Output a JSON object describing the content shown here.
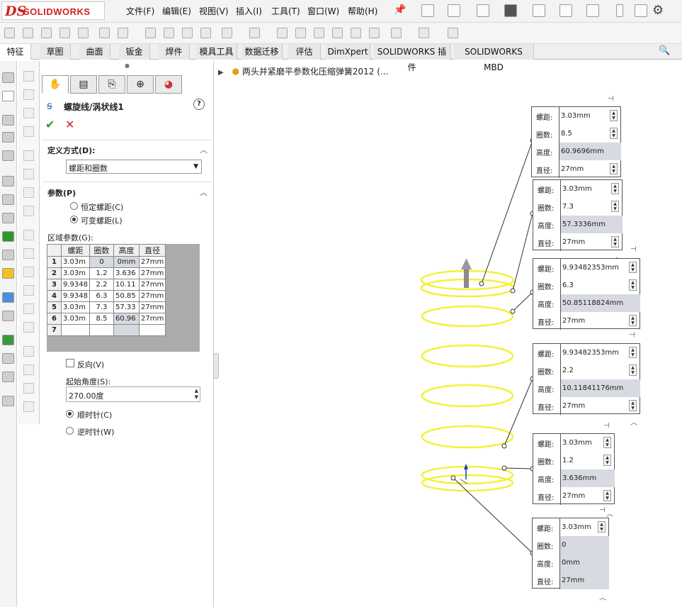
{
  "app": {
    "name": "SOLIDWORKS",
    "logo_ds": "DS"
  },
  "menu": [
    "文件(F)",
    "编辑(E)",
    "视图(V)",
    "插入(I)",
    "工具(T)",
    "窗口(W)",
    "帮助(H)"
  ],
  "tabs": [
    "特征",
    "草图",
    "曲面",
    "钣金",
    "焊件",
    "模具工具",
    "数据迁移",
    "评估",
    "DimXpert",
    "SOLIDWORKS 插件",
    "SOLIDWORKS MBD"
  ],
  "feature_tree": {
    "title": "两头并紧磨平参数化压缩弹簧2012 (..."
  },
  "property_manager": {
    "title": "螺旋线/涡状线1",
    "definition": {
      "title": "定义方式(D):",
      "selected": "螺距和圈数"
    },
    "parameters": {
      "title": "参数(P)",
      "options": [
        "恒定螺距(C)",
        "可变螺距(L)"
      ],
      "selected_index": 1,
      "region_label": "区域参数(G):",
      "columns": [
        "螺距",
        "圈数",
        "高度",
        "直径"
      ],
      "rows": [
        [
          "1",
          "3.03m",
          "0",
          "0mm",
          "27mm"
        ],
        [
          "2",
          "3.03m",
          "1.2",
          "3.636",
          "27mm"
        ],
        [
          "3",
          "9.9348",
          "2.2",
          "10.11",
          "27mm"
        ],
        [
          "4",
          "9.9348",
          "6.3",
          "50.85",
          "27mm"
        ],
        [
          "5",
          "3.03m",
          "7.3",
          "57.33",
          "27mm"
        ],
        [
          "6",
          "3.03m",
          "8.5",
          "60.96",
          "27mm"
        ],
        [
          "7",
          "",
          "",
          "",
          ""
        ]
      ],
      "reverse_label": "反向(V)",
      "start_angle_label": "起始角度(S):",
      "start_angle_value": "270.00度",
      "direction_options": [
        "顺时针(C)",
        "逆时针(W)"
      ],
      "direction_selected": 0
    }
  },
  "callouts": [
    {
      "pitch": "3.03mm",
      "turns": "8.5",
      "height": "60.9696mm",
      "diameter": "27mm"
    },
    {
      "pitch": "3.03mm",
      "turns": "7.3",
      "height": "57.3336mm",
      "diameter": "27mm"
    },
    {
      "pitch": "9.93482353mm",
      "turns": "6.3",
      "height": "50.85118824mm",
      "diameter": "27mm"
    },
    {
      "pitch": "9.93482353mm",
      "turns": "2.2",
      "height": "10.11841176mm",
      "diameter": "27mm"
    },
    {
      "pitch": "3.03mm",
      "turns": "1.2",
      "height": "3.636mm",
      "diameter": "27mm"
    },
    {
      "pitch": "3.03mm",
      "turns": "0",
      "height": "0mm",
      "diameter": "27mm"
    }
  ],
  "callout_labels": {
    "pitch": "螺距:",
    "turns": "圈数:",
    "height": "高度:",
    "diameter": "直径:"
  },
  "colors": {
    "helix": "#f5f03a",
    "brand": "#d0201e",
    "accept": "#2a9a2a",
    "cancel": "#cc2222"
  }
}
